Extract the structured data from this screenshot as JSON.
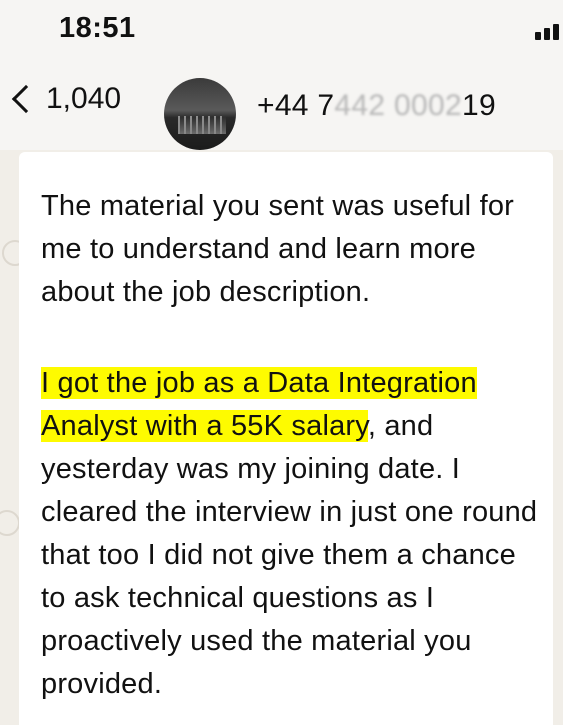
{
  "status_bar": {
    "time": "18:51"
  },
  "header": {
    "back_count": "1,040",
    "contact_prefix": "+44 7",
    "contact_masked": "442 0002",
    "contact_suffix": "19"
  },
  "message": {
    "paragraph1": "The material you sent was useful for me to understand and learn more about the job description.",
    "highlight_line1": "I got the job as a Data Integration",
    "highlight_line2": "Analyst with a 55K salary",
    "after_highlight": ", and yesterday was my joining date. I cleared the interview in just one round that too I did not give them a chance to ask technical questions as I proactively used the material you provided."
  },
  "colors": {
    "highlight": "#fefb00",
    "background": "#f6f5f3",
    "bubble": "#ffffff"
  }
}
